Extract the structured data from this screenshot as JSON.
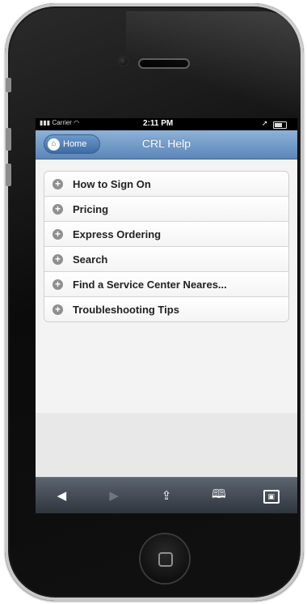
{
  "status_bar": {
    "carrier": "Carrier",
    "time": "2:11 PM",
    "location_icon": "location-arrow-icon",
    "battery_icon": "battery-icon"
  },
  "header": {
    "home_button_label": "Home",
    "title": "CRL Help",
    "bar_color": "#5b86b8"
  },
  "help_list": {
    "items": [
      {
        "label": "How to Sign On"
      },
      {
        "label": "Pricing"
      },
      {
        "label": "Express Ordering"
      },
      {
        "label": "Search"
      },
      {
        "label": "Find a Service Center Neares..."
      },
      {
        "label": "Troubleshooting Tips"
      }
    ]
  },
  "browser_toolbar": {
    "back_icon": "back-arrow-icon",
    "forward_icon": "forward-arrow-icon",
    "share_icon": "share-icon",
    "bookmarks_icon": "bookmarks-icon",
    "tabs_icon": "tabs-icon"
  }
}
